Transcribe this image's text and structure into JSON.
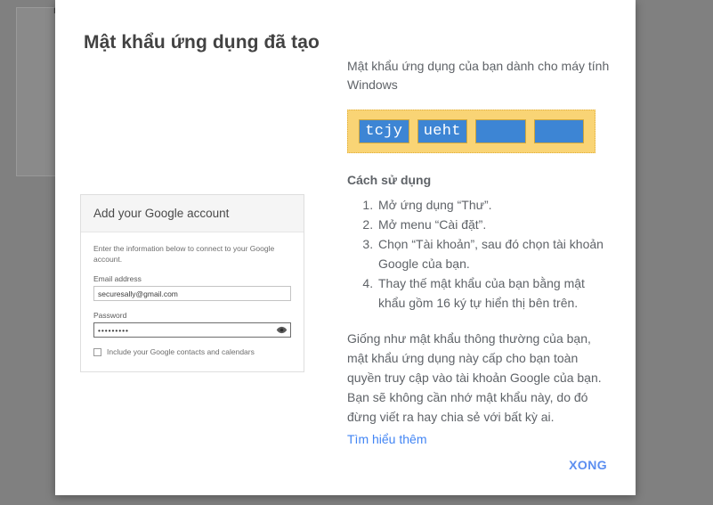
{
  "backdrop": {
    "obscured_text": "n"
  },
  "dialog": {
    "title": "Mật khẩu ứng dụng đã tạo",
    "done_button": "XONG"
  },
  "windows_card": {
    "header_title": "Add your Google account",
    "description": "Enter the information below to connect to your Google account.",
    "email_label": "Email address",
    "email_value": "securesally@gmail.com",
    "email_placeholder": "Email address",
    "password_label": "Password",
    "password_value": "•••••••••",
    "password_placeholder": "Password",
    "reveal_icon": "eye-icon",
    "checkbox_label": "Include your Google contacts and calendars",
    "checkbox_checked": false
  },
  "app_password": {
    "intro": "Mật khẩu ứng dụng của bạn dành cho máy tính Windows",
    "chunks": [
      "tcjy",
      "ueht",
      "",
      ""
    ],
    "box_color": "#f9d475",
    "chunk_color": "#3d85d4"
  },
  "how_to": {
    "title": "Cách sử dụng",
    "steps": [
      "Mở ứng dụng “Thư”.",
      "Mở menu “Cài đặt”.",
      "Chọn “Tài khoản”, sau đó chọn tài khoản Google của bạn.",
      "Thay thế mật khẩu của bạn bằng mật khẩu gồm 16 ký tự hiển thị bên trên."
    ]
  },
  "note": {
    "paragraph": "Giống như mật khẩu thông thường của bạn, mật khẩu ứng dụng này cấp cho bạn toàn quyền truy cập vào tài khoản Google của bạn. Bạn sẽ không cần nhớ mật khẩu này, do đó đừng viết ra hay chia sẻ với bất kỳ ai.",
    "learn_more": "Tìm hiểu thêm",
    "link_color": "#4285f4"
  }
}
